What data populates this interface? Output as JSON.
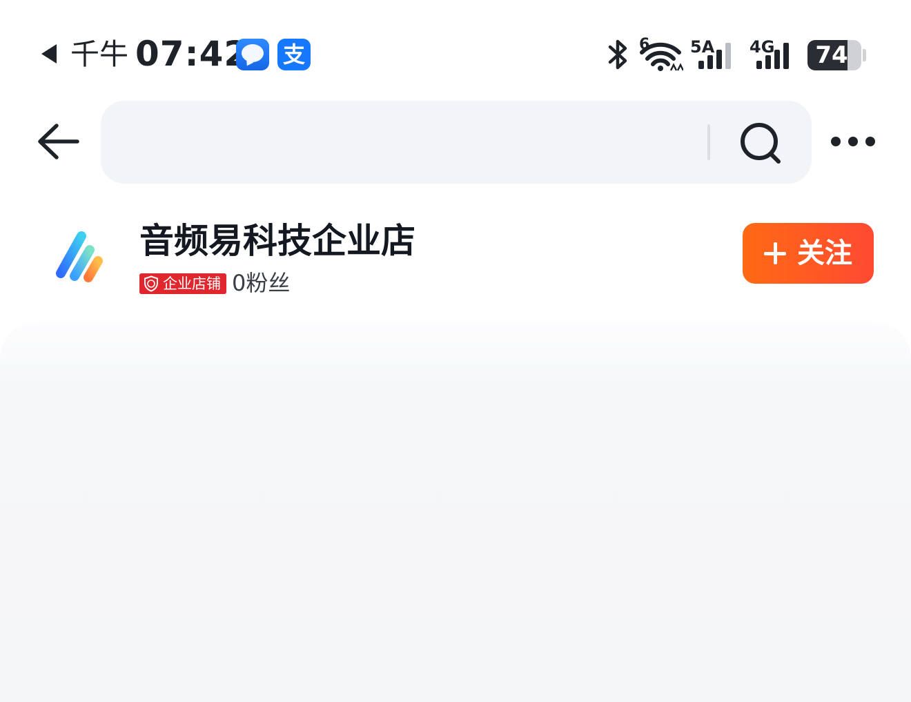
{
  "status_bar": {
    "carrier": "千牛",
    "time": "07:42",
    "apps": [
      "chat-app-icon",
      "alipay-app-icon"
    ],
    "alipay_glyph": "支",
    "wifi_label": "6",
    "signal_1_label": "5A",
    "signal_2_label": "4G",
    "battery_percent": "74",
    "battery_level": 0.74
  },
  "header": {
    "search_placeholder": "",
    "icons": {
      "back": "back-arrow-icon",
      "search": "search-icon",
      "more": "more-icon"
    }
  },
  "shop": {
    "name": "音频易科技企业店",
    "badge": "企业店铺",
    "fans_count": "0",
    "fans_label": "粉丝",
    "follow_label": "关注"
  },
  "colors": {
    "follow_gradient_start": "#ff6a14",
    "follow_gradient_end": "#ff4a32",
    "badge_red": "#e0272d",
    "search_bg": "#f3f4f7",
    "panel_bg": "#f5f6f8"
  }
}
